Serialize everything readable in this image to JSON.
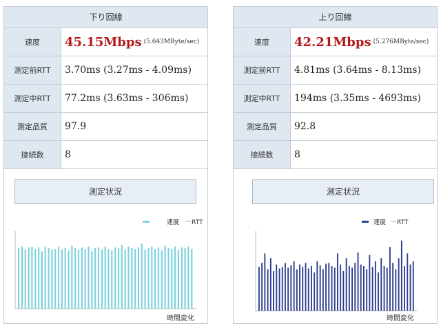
{
  "download": {
    "title": "下り回線",
    "rows": [
      {
        "label": "速度",
        "main": "45.15Mbps",
        "sub": "(5.643MByte/sec)"
      },
      {
        "label": "測定前RTT",
        "value": "3.70ms (3.27ms - 4.09ms)"
      },
      {
        "label": "測定中RTT",
        "value": "77.2ms (3.63ms - 306ms)"
      },
      {
        "label": "測定品質",
        "value": "97.9"
      },
      {
        "label": "接続数",
        "value": "8"
      }
    ],
    "status_button": "測定状況",
    "chart": {
      "legend_speed": "速度",
      "legend_rtt": "RTT",
      "xlabel": "時間変化",
      "speed_color": "#7fd2dd",
      "values": [
        0.78,
        0.8,
        0.76,
        0.79,
        0.8,
        0.77,
        0.79,
        0.74,
        0.8,
        0.78,
        0.76,
        0.77,
        0.8,
        0.76,
        0.78,
        0.75,
        0.81,
        0.78,
        0.76,
        0.79,
        0.77,
        0.8,
        0.74,
        0.78,
        0.79,
        0.76,
        0.8,
        0.77,
        0.75,
        0.79,
        0.78,
        0.82,
        0.76,
        0.8,
        0.78,
        0.77,
        0.79,
        0.84,
        0.76,
        0.78,
        0.8,
        0.77,
        0.79,
        0.75,
        0.81,
        0.78,
        0.77,
        0.8,
        0.76,
        0.79,
        0.78,
        0.8,
        0.77
      ]
    }
  },
  "upload": {
    "title": "上り回線",
    "rows": [
      {
        "label": "速度",
        "main": "42.21Mbps",
        "sub": "(5.276MByte/sec)"
      },
      {
        "label": "測定前RTT",
        "value": "4.81ms (3.64ms - 8.13ms)"
      },
      {
        "label": "測定中RTT",
        "value": "194ms (3.35ms - 4693ms)"
      },
      {
        "label": "測定品質",
        "value": "92.8"
      },
      {
        "label": "接続数",
        "value": "8"
      }
    ],
    "status_button": "測定状況",
    "chart": {
      "legend_speed": "速度",
      "legend_rtt": "RTT",
      "xlabel": "時間変化",
      "speed_color": "#2f3f8f",
      "values": [
        0.55,
        0.6,
        0.72,
        0.52,
        0.66,
        0.5,
        0.58,
        0.53,
        0.55,
        0.6,
        0.54,
        0.57,
        0.62,
        0.52,
        0.58,
        0.55,
        0.6,
        0.53,
        0.56,
        0.48,
        0.62,
        0.57,
        0.52,
        0.59,
        0.6,
        0.56,
        0.54,
        0.72,
        0.58,
        0.5,
        0.66,
        0.56,
        0.54,
        0.6,
        0.73,
        0.58,
        0.56,
        0.52,
        0.7,
        0.55,
        0.62,
        0.48,
        0.66,
        0.56,
        0.54,
        0.8,
        0.6,
        0.52,
        0.66,
        0.88,
        0.56,
        0.72,
        0.58,
        0.62
      ]
    }
  }
}
